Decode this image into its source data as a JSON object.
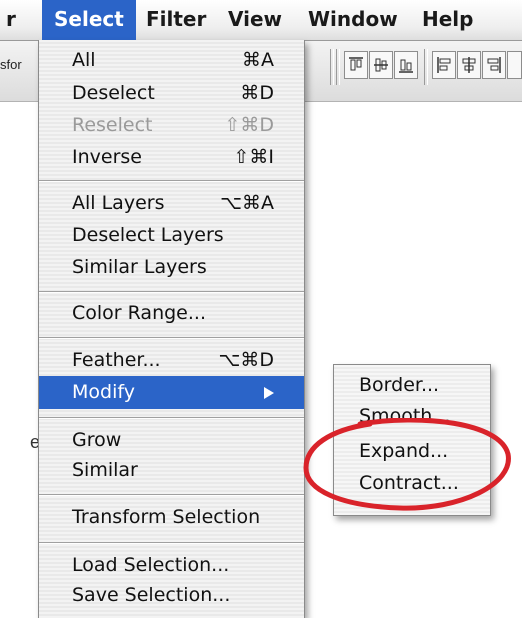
{
  "menubar": {
    "items": [
      {
        "label": "r"
      },
      {
        "label": "Select"
      },
      {
        "label": "Filter"
      },
      {
        "label": "View"
      },
      {
        "label": "Window"
      },
      {
        "label": "Help"
      }
    ]
  },
  "toolbar": {
    "left_text": "sfor"
  },
  "left_sliver_text": "e",
  "select_menu": {
    "items": [
      {
        "label": "All",
        "shortcut": "⌘A"
      },
      {
        "label": "Deselect",
        "shortcut": "⌘D"
      },
      {
        "label": "Reselect",
        "shortcut": "⇧⌘D",
        "disabled": true
      },
      {
        "label": "Inverse",
        "shortcut": "⇧⌘I"
      },
      {
        "label": "All Layers",
        "shortcut": "⌥⌘A"
      },
      {
        "label": "Deselect Layers",
        "shortcut": ""
      },
      {
        "label": "Similar Layers",
        "shortcut": ""
      },
      {
        "label": "Color Range...",
        "shortcut": ""
      },
      {
        "label": "Feather...",
        "shortcut": "⌥⌘D"
      },
      {
        "label": "Modify",
        "shortcut": "",
        "submenu": true,
        "highlighted": true
      },
      {
        "label": "Grow",
        "shortcut": ""
      },
      {
        "label": "Similar",
        "shortcut": ""
      },
      {
        "label": "Transform Selection",
        "shortcut": ""
      },
      {
        "label": "Load Selection...",
        "shortcut": ""
      },
      {
        "label": "Save Selection...",
        "shortcut": ""
      }
    ]
  },
  "modify_submenu": {
    "items": [
      {
        "label": "Border..."
      },
      {
        "label": "Smooth..."
      },
      {
        "label": "Expand..."
      },
      {
        "label": "Contract..."
      }
    ]
  },
  "colors": {
    "highlight": "#2b64c8",
    "annotation": "#d9232a",
    "disabled_text": "#9a9a9a"
  }
}
